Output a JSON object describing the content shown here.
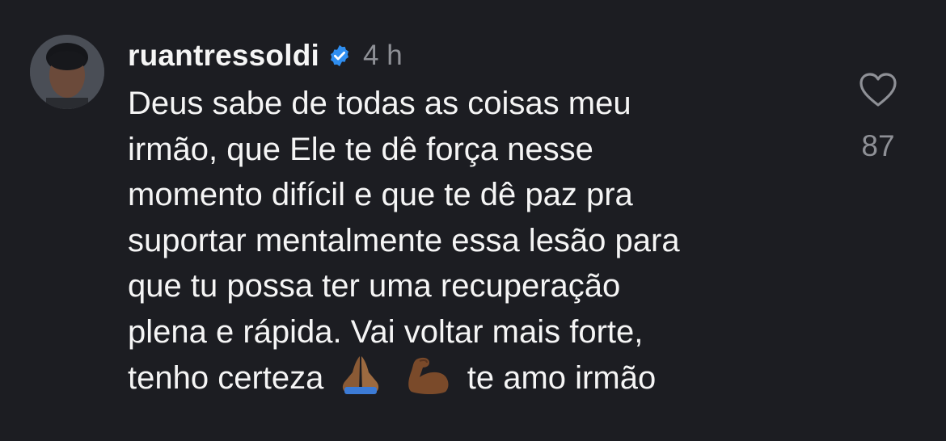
{
  "comment": {
    "username": "ruantressoldi",
    "verified": true,
    "timestamp": "4 h",
    "lines": [
      "Deus sabe de todas as coisas meu",
      "irmão, que Ele te dê força nesse",
      "momento difícil e que te dê paz pra",
      "suportar mentalmente essa lesão para",
      "que tu possa ter uma recuperação",
      "plena e rápida. Vai voltar mais forte,"
    ],
    "last_line": {
      "before_emoji": "tenho certeza",
      "emojis": [
        "folded-hands",
        "flexed-biceps"
      ],
      "after_emoji": "te amo irmão"
    },
    "likes": "87"
  },
  "colors": {
    "background": "#1c1d22",
    "text": "#f5f5f5",
    "muted": "#8e9096",
    "verified": "#2f8ef0"
  }
}
